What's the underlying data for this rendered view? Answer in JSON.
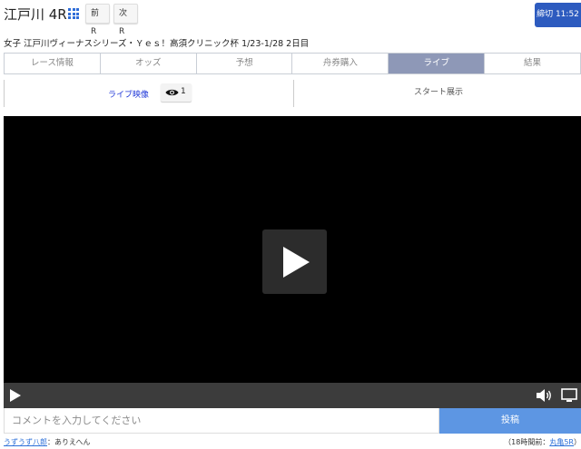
{
  "header": {
    "race_title": "江戸川 4R",
    "prev_label": "前R",
    "next_label": "次R",
    "deadline_label": "締切 11:52"
  },
  "subtitle": "女子 江戸川ヴィーナスシリーズ・Ｙｅｓ！高須クリニック杯 1/23-1/28 2日目",
  "tabs": [
    {
      "label": "レース情報",
      "active": false
    },
    {
      "label": "オッズ",
      "active": false
    },
    {
      "label": "予想",
      "active": false
    },
    {
      "label": "舟券購入",
      "active": false
    },
    {
      "label": "ライブ",
      "active": true
    },
    {
      "label": "結果",
      "active": false
    }
  ],
  "subtabs": {
    "live_label": "ライブ映像",
    "viewer_count": "1",
    "start_label": "スタート展示"
  },
  "comment": {
    "placeholder": "コメントを入力してください",
    "post_label": "投稿"
  },
  "latest_comment": {
    "user": "うずうず八郎",
    "separator": "：",
    "text": "ありえへん",
    "meta_prefix": "（18時間前：",
    "meta_link": "丸亀5R",
    "meta_suffix": "）"
  },
  "colors": {
    "accent": "#2d5bbf",
    "active_tab": "#8e98b7",
    "post_button": "#5d96e3",
    "link": "#2b6fd8"
  }
}
